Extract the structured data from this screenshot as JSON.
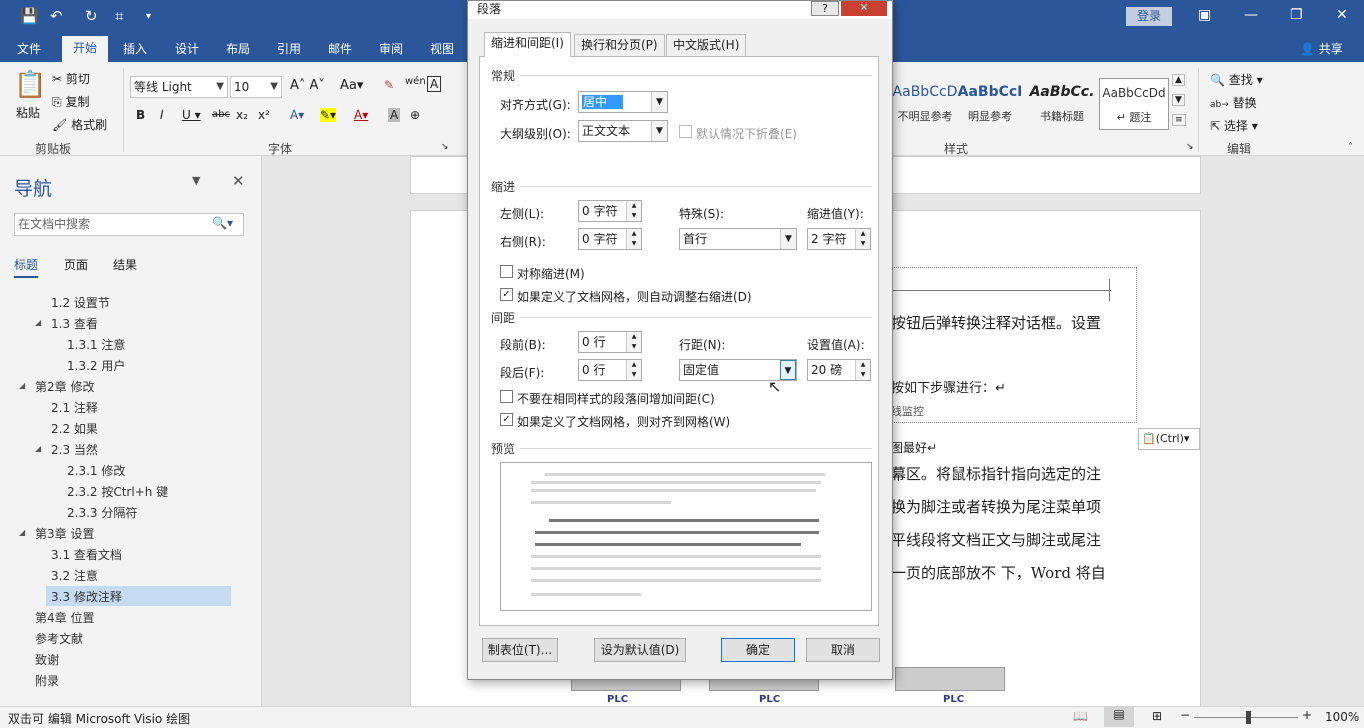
{
  "titlebar": {
    "login": "登录"
  },
  "tabs": [
    "文件",
    "开始",
    "插入",
    "设计",
    "布局",
    "引用",
    "邮件",
    "审阅",
    "视图"
  ],
  "share": "共享",
  "ribbon": {
    "paste": "粘贴",
    "cut": "剪切",
    "copy": "复制",
    "format_painter": "格式刷",
    "clipboard_label": "剪贴板",
    "font_name": "等线 Light",
    "font_size": "10",
    "font_label": "字体",
    "styles": [
      {
        "sample": "AaBbCcD",
        "name": "不明显参考"
      },
      {
        "sample": "AaBbCcI",
        "name": "明显参考"
      },
      {
        "sample": "AaBbCc.",
        "name": "书籍标题"
      },
      {
        "sample": "AaBbCcDd",
        "name": "↵ 题注"
      }
    ],
    "styles_label": "样式",
    "find": "查找",
    "replace": "替换",
    "select": "选择",
    "edit_label": "编辑"
  },
  "nav": {
    "title": "导航",
    "search_placeholder": "在文档中搜索",
    "tabs": [
      "标题",
      "页面",
      "结果"
    ],
    "items": [
      {
        "text": "1.2 设置节"
      },
      {
        "text": "1.3 查看"
      },
      {
        "text": "1.3.1 注意"
      },
      {
        "text": "1.3.2 用户"
      },
      {
        "text": "第2章 修改"
      },
      {
        "text": "2.1 注释"
      },
      {
        "text": "2.2 如果"
      },
      {
        "text": "2.3 当然"
      },
      {
        "text": "2.3.1 修改"
      },
      {
        "text": "2.3.2 按Ctrl+h 键"
      },
      {
        "text": "2.3.3 分隔符"
      },
      {
        "text": "第3章 设置"
      },
      {
        "text": "3.1 查看文档"
      },
      {
        "text": "3.2 注意"
      },
      {
        "text": "3.3 修改注释"
      },
      {
        "text": "第4章 位置"
      },
      {
        "text": "参考文献"
      },
      {
        "text": "致谢"
      },
      {
        "text": "附录"
      }
    ]
  },
  "doc": {
    "lines": [
      "按钮后弹转换注释对话框。设置",
      "按如下步骤进行：↵",
      "线监控",
      "图最好↵",
      "幕区。将鼠标指针指向选定的注",
      "换为脚注或者转换为尾注菜单项",
      "平线段将文档正文与脚注或尾注",
      "一页的底部放不 下，Word 将自"
    ],
    "paste_options": "(Ctrl)",
    "plc_labels": [
      "PLC",
      "PLC",
      "PLC"
    ]
  },
  "status": {
    "left": "双击可 编辑 Microsoft Visio 绘图",
    "zoom": "100%"
  },
  "dialog": {
    "title": "段落",
    "help": "?",
    "tabs": [
      "缩进和间距(I)",
      "换行和分页(P)",
      "中文版式(H)"
    ],
    "general": "常规",
    "alignment_label": "对齐方式(G):",
    "alignment_value": "居中",
    "outline_label": "大纲级别(O):",
    "outline_value": "正文文本",
    "collapse_label": "默认情况下折叠(E)",
    "indent": "缩进",
    "left_label": "左侧(L):",
    "left_value": "0 字符",
    "right_label": "右侧(R):",
    "right_value": "0 字符",
    "special_label": "特殊(S):",
    "special_value": "首行",
    "indent_by_label": "缩进值(Y):",
    "indent_by_value": "2 字符",
    "mirror_label": "对称缩进(M)",
    "auto_indent_label": "如果定义了文档网格，则自动调整右缩进(D)",
    "spacing": "间距",
    "before_label": "段前(B):",
    "before_value": "0 行",
    "after_label": "段后(F):",
    "after_value": "0 行",
    "line_spacing_label": "行距(N):",
    "line_spacing_value": "固定值",
    "at_label": "设置值(A):",
    "at_value": "20 磅",
    "no_space_label": "不要在相同样式的段落间增加间距(C)",
    "snap_grid_label": "如果定义了文档网格，则对齐到网格(W)",
    "preview": "预览",
    "tabs_button": "制表位(T)...",
    "default_button": "设为默认值(D)",
    "ok_button": "确定",
    "cancel_button": "取消"
  }
}
